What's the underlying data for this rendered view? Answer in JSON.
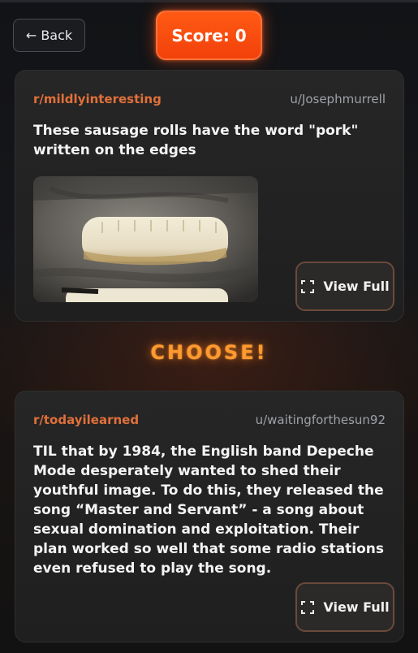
{
  "header": {
    "back_label": "← Back",
    "score_label": "Score: 0"
  },
  "post_a": {
    "subreddit": "r/mildlyinteresting",
    "author": "u/Josephmurrell",
    "title": "These sausage rolls have the word \"pork\" written on the edges",
    "image_alt": "Sausage rolls on a baking tray",
    "view_full_label": "View Full"
  },
  "prompt": {
    "choose_label": "CHOOSE!"
  },
  "post_b": {
    "subreddit": "r/todayilearned",
    "author": "u/waitingforthesun92",
    "title": "TIL that by 1984, the English band Depeche Mode desperately wanted to shed their youthful image. To do this, they released the song “Master and Servant” - a song about sexual domination and exploitation. Their plan worked so well that some radio stations even refused to play the song.",
    "view_full_label": "View Full"
  },
  "colors": {
    "accent": "#ff4f10",
    "subreddit": "#e0703a",
    "choose": "#ff9a2e"
  },
  "icons": {
    "expand": "expand-icon"
  }
}
